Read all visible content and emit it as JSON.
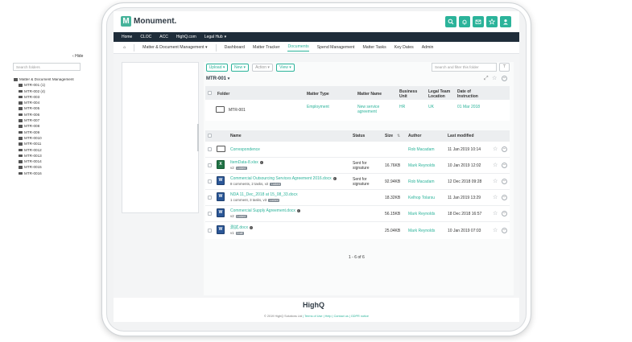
{
  "header": {
    "logo_letter": "M",
    "logo_text": "Monument.",
    "icons": [
      "search-icon",
      "bell-icon",
      "mail-icon",
      "star-icon",
      "user-icon"
    ]
  },
  "topnav": [
    "Home",
    "CLOC",
    "ACC",
    "HighQ.com",
    "Legal Hub"
  ],
  "topnav_caret": "▾",
  "subnav": {
    "home_icon": "⌂",
    "section": "Matter & Document Management",
    "caret": "▾",
    "tabs": [
      "Dashboard",
      "Matter Tracker",
      "Documents",
      "Spend Management",
      "Matter Tasks",
      "Key Dates",
      "Admin"
    ],
    "active_tab": "Documents"
  },
  "folders_panel": {
    "hide_label": "Hide",
    "hide_chevron": "‹",
    "search_placeholder": "Search folders",
    "root": "Matter & Document Management",
    "items": [
      "MTR-001 (1)",
      "MTR-002 (4)",
      "MTR-003",
      "MTR-004",
      "MTR-005",
      "MTR-006",
      "MTR-007",
      "MTR-008",
      "MTR-009",
      "MTR-0010",
      "MTR-0011",
      "MTR-0012",
      "MTR-0013",
      "MTR-0014",
      "MTR-0015",
      "MTR-0016"
    ]
  },
  "toolbar": {
    "upload": "Upload ▾",
    "new": "New ▾",
    "action": "Action ▾",
    "view": "View ▾",
    "search_placeholder": "Search and filter this folder",
    "filter_icon": "⊤"
  },
  "path": {
    "label": "MTR-001",
    "caret": "▾"
  },
  "folder_table": {
    "headers": [
      "Folder",
      "Matter Type",
      "Matter Name",
      "Business Unit",
      "Legal Team Location",
      "Date of Instruction"
    ],
    "row": {
      "folder": "MTR-001",
      "matter_type": "Employment",
      "matter_name": "New service agreement",
      "business_unit": "HR",
      "location": "UK",
      "date": "01 Mar 2018"
    }
  },
  "doc_table": {
    "headers": [
      "Name",
      "Status",
      "Size",
      "Author",
      "Last modified"
    ],
    "sort_icon": "⇅",
    "rows": [
      {
        "name": "Correspondence",
        "meta": "",
        "badge": "",
        "status": "",
        "size": "",
        "author": "Rob Macadam",
        "modified": "11 Jan 2019 10:14",
        "icon": "folder"
      },
      {
        "name": "ItemData-8.xlsx",
        "meta": "v2",
        "badge": "Locked",
        "status": "Sent for signature",
        "size": "16.76KB",
        "author": "Mark Reynolds",
        "modified": "10 Jan 2019 12:02",
        "icon": "excel"
      },
      {
        "name": "Commercial Outsourcing Services Agreement 2016.docx",
        "meta": "8 comments, 2 tasks, v2",
        "badge": "Locked",
        "status": "Sent for signature",
        "size": "92.94KB",
        "author": "Rob Macadam",
        "modified": "12 Dec 2018 09:28",
        "icon": "word"
      },
      {
        "name": "NDA 11_Dec_2018 at 15_08_33.docx",
        "meta": "1 comment, 3 tasks, v3",
        "badge": "Locked",
        "status": "",
        "size": "18.32KB",
        "author": "Kelhop Tolarsu",
        "modified": "11 Jan 2019 13:29",
        "icon": "word"
      },
      {
        "name": "Commercial Supply Agreement.docx",
        "meta": "v2",
        "badge": "Locked",
        "status": "",
        "size": "56.15KB",
        "author": "Mark Reynolds",
        "modified": "18 Dec 2018 16:57",
        "icon": "word"
      },
      {
        "name": "測試.docx",
        "meta": "v1",
        "badge": "Draft",
        "status": "",
        "size": "25.04KB",
        "author": "Mark Reynolds",
        "modified": "10 Jan 2019 07:03",
        "icon": "word"
      }
    ],
    "pagination": "1 - 6 of 6"
  },
  "footer": {
    "logo": "HighQ",
    "copyright": "© 2019 HighQ Solutions Ltd",
    "links": [
      "Terms of Use",
      "Help",
      "Contact us",
      "GDPR notice"
    ]
  }
}
